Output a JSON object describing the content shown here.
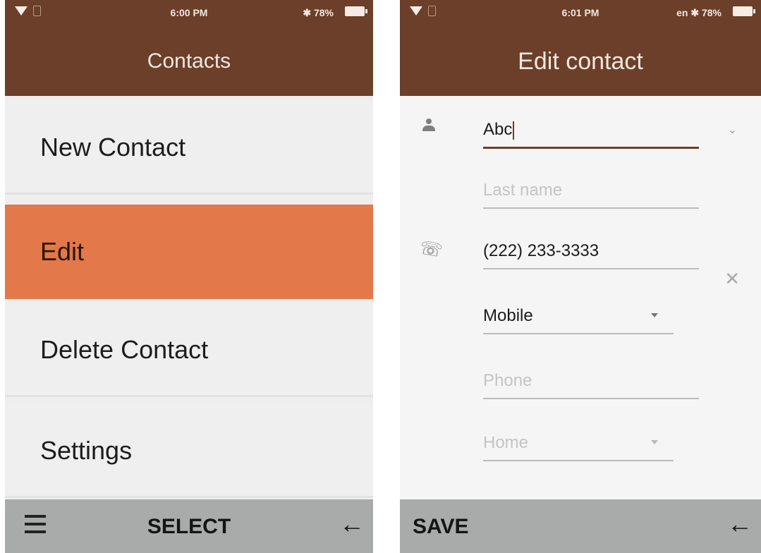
{
  "left_screen": {
    "status": {
      "time": "6:00 PM",
      "right": "✱ 78%"
    },
    "header_title": "Contacts",
    "menu": [
      {
        "label": "New Contact",
        "selected": false
      },
      {
        "label": "Edit",
        "selected": true
      },
      {
        "label": "Delete Contact",
        "selected": false
      },
      {
        "label": "Settings",
        "selected": false
      }
    ],
    "softkeys": {
      "left_icon": "hamburger-menu-icon",
      "center": "SELECT",
      "right_icon": "back-arrow-icon",
      "right": "←"
    }
  },
  "right_screen": {
    "status": {
      "time": "6:01 PM",
      "right": "en ✱ 78%"
    },
    "header_title": "Edit contact",
    "form": {
      "first_name": {
        "value": "Abc",
        "placeholder": ""
      },
      "last_name": {
        "placeholder": "Last name"
      },
      "phone1": {
        "value": "(222) 233-3333"
      },
      "phone1_type": "Mobile",
      "phone2": {
        "placeholder": "Phone"
      },
      "phone2_type": "Home",
      "icons": {
        "name": "person-icon",
        "phone": "phone-icon",
        "expand": "chevron-down-icon",
        "remove": "close-icon"
      },
      "glyphs": {
        "phone": "☏",
        "chevron": "⌄",
        "close": "✕"
      }
    },
    "softkeys": {
      "left": "SAVE",
      "right": "←"
    }
  },
  "colors": {
    "header": "#6b3f29",
    "selected": "#e3784a",
    "softkey_bar": "#a9aaaa",
    "background": "#efefef"
  }
}
